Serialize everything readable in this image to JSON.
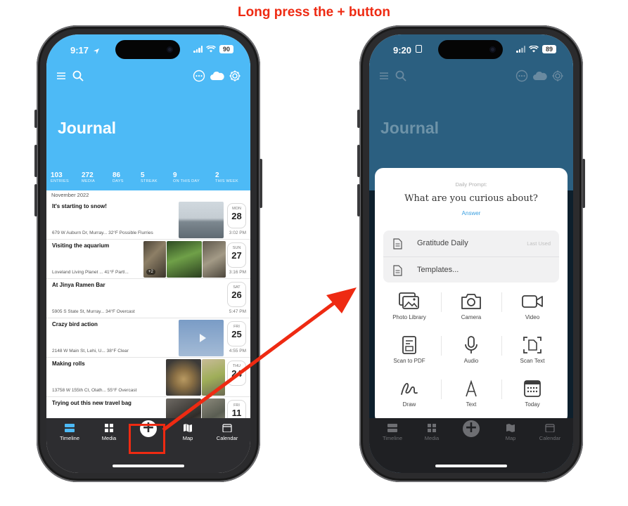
{
  "annotation": {
    "headline": "Long press the + button",
    "highlight_color": "#ee2a12"
  },
  "left_phone": {
    "status": {
      "time": "9:17",
      "battery": "90"
    },
    "header": {
      "title": "Journal",
      "bg_color": "#4dbaf6",
      "icons": [
        "menu-icon",
        "search-icon",
        "more-icon",
        "cloud-icon",
        "gear-icon"
      ],
      "stats": [
        {
          "value": "103",
          "label": "ENTRIES"
        },
        {
          "value": "272",
          "label": "MEDIA"
        },
        {
          "value": "86",
          "label": "DAYS"
        },
        {
          "value": "5",
          "label": "STREAK"
        },
        {
          "value": "9",
          "label": "ON THIS DAY"
        },
        {
          "value": "2",
          "label": "THIS WEEK"
        }
      ]
    },
    "month": "November 2022",
    "entries": [
      {
        "title": "It's starting to snow!",
        "meta": "679 W Auburn Dr, Murray... 32°F Possible Flurries",
        "dow": "MON",
        "day": "28",
        "time": "3:02 PM"
      },
      {
        "title": "Visiting the aquarium",
        "meta": "Loveland Living Planet ... 41°F Partl...",
        "dow": "SUN",
        "day": "27",
        "time": "3:16 PM",
        "badge": "+2"
      },
      {
        "title": "At Jinya Ramen Bar",
        "meta": "5905 S State St, Murray... 34°F Overcast",
        "dow": "SAT",
        "day": "26",
        "time": "5:47 PM"
      },
      {
        "title": "Crazy bird action",
        "meta": "2148 W Main St, Lehi, U... 38°F Clear",
        "dow": "FRI",
        "day": "25",
        "time": "4:55 PM"
      },
      {
        "title": "Making rolls",
        "meta": "13758 W 155th Ct, Olath... 55°F Overcast",
        "dow": "THU",
        "day": "24",
        "time": ""
      },
      {
        "title": "Trying out this new travel bag",
        "meta": "",
        "dow": "FRI",
        "day": "11",
        "time": ""
      }
    ],
    "tabs": [
      {
        "label": "Timeline"
      },
      {
        "label": "Media"
      },
      {
        "label": "+"
      },
      {
        "label": "Map"
      },
      {
        "label": "Calendar"
      }
    ]
  },
  "right_phone": {
    "status": {
      "time": "9:20",
      "battery": "89"
    },
    "header": {
      "title": "Journal"
    },
    "sheet": {
      "prompt_label": "Daily Prompt:",
      "prompt_question": "What are you curious about?",
      "prompt_link": "Answer",
      "templates": [
        {
          "label": "Gratitude Daily",
          "meta": "Last Used",
          "icon": "document-icon"
        },
        {
          "label": "Templates...",
          "meta": "",
          "icon": "document-icon"
        }
      ],
      "actions": [
        {
          "label": "Photo Library",
          "icon": "photo-library-icon"
        },
        {
          "label": "Camera",
          "icon": "camera-icon"
        },
        {
          "label": "Video",
          "icon": "video-icon"
        },
        {
          "label": "Scan to PDF",
          "icon": "scan-pdf-icon"
        },
        {
          "label": "Audio",
          "icon": "microphone-icon"
        },
        {
          "label": "Scan Text",
          "icon": "scan-text-icon"
        },
        {
          "label": "Draw",
          "icon": "draw-icon"
        },
        {
          "label": "Text",
          "icon": "text-icon"
        },
        {
          "label": "Today",
          "icon": "calendar-icon"
        }
      ]
    },
    "tabs": [
      {
        "label": "Timeline"
      },
      {
        "label": "Media"
      },
      {
        "label": "+"
      },
      {
        "label": "Map"
      },
      {
        "label": "Calendar"
      }
    ]
  }
}
